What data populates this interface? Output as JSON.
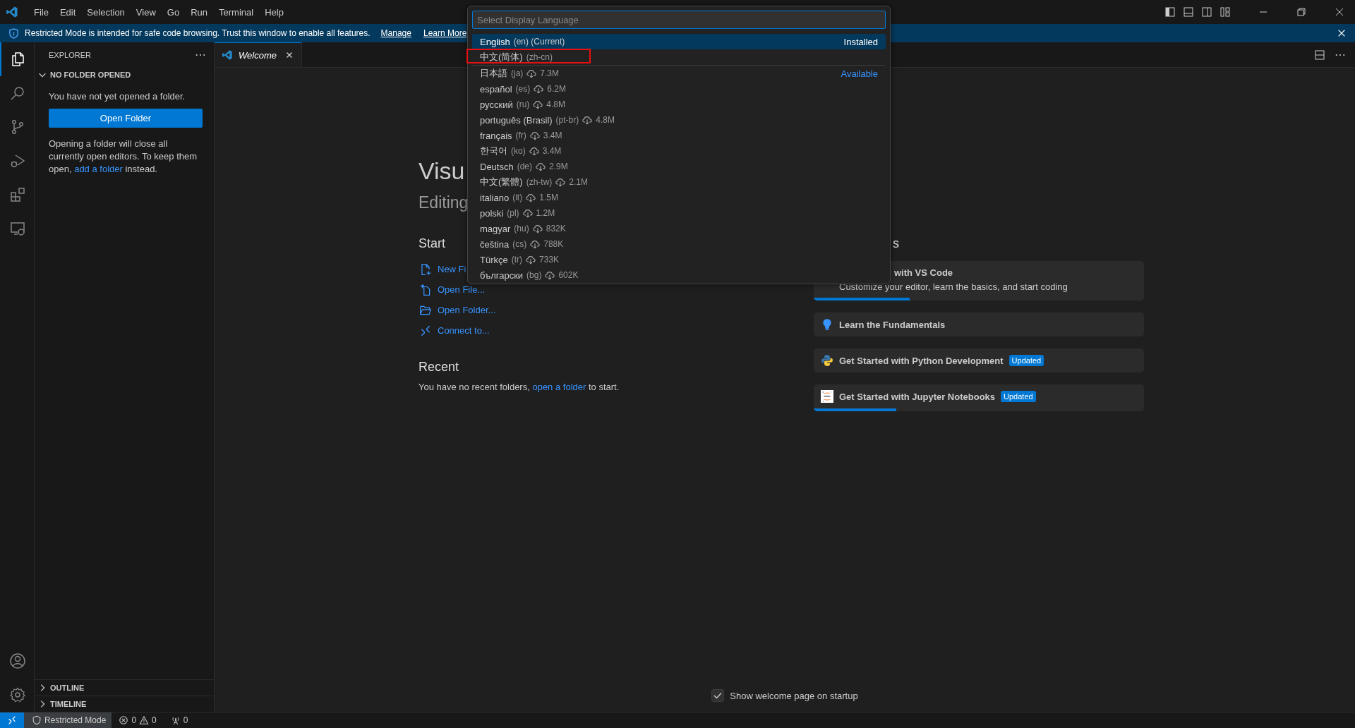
{
  "menu": [
    "File",
    "Edit",
    "Selection",
    "View",
    "Go",
    "Run",
    "Terminal",
    "Help"
  ],
  "banner": {
    "message": "Restricted Mode is intended for safe code browsing. Trust this window to enable all features.",
    "links": [
      "Manage",
      "Learn More"
    ]
  },
  "activity_bar": {
    "items": [
      {
        "kind": "explorer",
        "selected": true
      },
      {
        "kind": "search",
        "selected": false
      },
      {
        "kind": "source-control",
        "selected": false
      },
      {
        "kind": "run",
        "selected": false
      },
      {
        "kind": "extensions",
        "selected": false
      },
      {
        "kind": "remote",
        "selected": false
      }
    ],
    "bottom": [
      {
        "kind": "accounts"
      },
      {
        "kind": "settings"
      }
    ]
  },
  "sidebar": {
    "title": "EXPLORER",
    "section": {
      "title": "NO FOLDER OPENED",
      "expanded": true,
      "message": "You have not yet opened a folder.",
      "button": "Open Folder",
      "note_before": "Opening a folder will close all currently open editors. To keep them open,",
      "note_link": "add a folder",
      "note_after": "instead."
    },
    "panels": [
      {
        "title": "OUTLINE",
        "expanded": false
      },
      {
        "title": "TIMELINE",
        "expanded": false
      }
    ]
  },
  "tabs": [
    {
      "label": "Welcome",
      "selected": true
    }
  ],
  "welcome": {
    "title": "Visu",
    "subtitle": "Editing",
    "start_heading": "Start",
    "start_items": [
      {
        "kind": "new-file",
        "label": "New Fi"
      },
      {
        "kind": "open-file",
        "label": "Open File..."
      },
      {
        "kind": "open-folder",
        "label": "Open Folder..."
      },
      {
        "kind": "connect",
        "label": "Connect to..."
      }
    ],
    "recent_heading": "Recent",
    "recent_before": "You have no recent folders,",
    "recent_link": "open a folder",
    "recent_after": "to start.",
    "walkthroughs_heading": "s",
    "walkthroughs": [
      {
        "kind": "covered",
        "title": "with VS Code",
        "description": "Customize your editor, learn the basics, and start coding",
        "level": 0.29
      },
      {
        "kind": "bulb",
        "title": "Learn the Fundamentals"
      },
      {
        "kind": "python",
        "title": "Get Started with Python Development",
        "badge": "Updated"
      },
      {
        "kind": "jupyter",
        "title": "Get Started with Jupyter Notebooks",
        "badge": "Updated",
        "level": 0.25
      }
    ],
    "show_on_startup": {
      "label": "Show welcome page on startup",
      "checked": true
    }
  },
  "quick_pick": {
    "placeholder": "Select Display Language",
    "items": [
      {
        "name": "English",
        "code": "(en) (Current)",
        "group": "Installed",
        "selected": true,
        "highlighted": false
      },
      {
        "name": "中文(简体)",
        "code": "(zh-cn)",
        "selected": false,
        "highlighted": true
      },
      {
        "name": "日本語",
        "code": "(ja)",
        "size": "7.3M",
        "group": "Available",
        "selected": false,
        "highlighted": false
      },
      {
        "name": "español",
        "code": "(es)",
        "size": "6.2M",
        "selected": false,
        "highlighted": false
      },
      {
        "name": "русский",
        "code": "(ru)",
        "size": "4.8M",
        "selected": false,
        "highlighted": false
      },
      {
        "name": "português (Brasil)",
        "code": "(pt-br)",
        "size": "4.8M",
        "selected": false,
        "highlighted": false
      },
      {
        "name": "français",
        "code": "(fr)",
        "size": "3.4M",
        "selected": false,
        "highlighted": false
      },
      {
        "name": "한국어",
        "code": "(ko)",
        "size": "3.4M",
        "selected": false,
        "highlighted": false
      },
      {
        "name": "Deutsch",
        "code": "(de)",
        "size": "2.9M",
        "selected": false,
        "highlighted": false
      },
      {
        "name": "中文(繁體)",
        "code": "(zh-tw)",
        "size": "2.1M",
        "selected": false,
        "highlighted": false
      },
      {
        "name": "italiano",
        "code": "(it)",
        "size": "1.5M",
        "selected": false,
        "highlighted": false
      },
      {
        "name": "polski",
        "code": "(pl)",
        "size": "1.2M",
        "selected": false,
        "highlighted": false
      },
      {
        "name": "magyar",
        "code": "(hu)",
        "size": "832K",
        "selected": false,
        "highlighted": false
      },
      {
        "name": "čeština",
        "code": "(cs)",
        "size": "788K",
        "selected": false,
        "highlighted": false
      },
      {
        "name": "Türkçe",
        "code": "(tr)",
        "size": "733K",
        "selected": false,
        "highlighted": false
      },
      {
        "name": "български",
        "code": "(bg)",
        "size": "602K",
        "selected": false,
        "highlighted": false
      }
    ]
  },
  "status_bar": {
    "restricted": "Restricted Mode",
    "errors": "0",
    "warnings": "0",
    "ports": "0"
  }
}
